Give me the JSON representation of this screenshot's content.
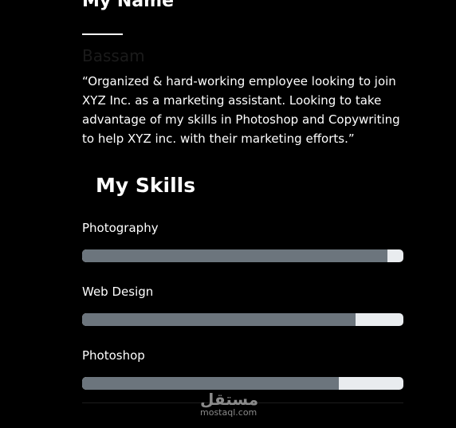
{
  "profile": {
    "heading": "My Name",
    "name": "Bassam",
    "bio": "“Organized & hard-working employee looking to join XYZ Inc. as a marketing assistant. Looking to take advantage of my skills in Photoshop and Copywriting to help XYZ inc. with their marketing efforts.”"
  },
  "skills": {
    "heading": "My Skills",
    "items": [
      {
        "label": "Photography",
        "level": 0.95
      },
      {
        "label": "Web Design",
        "level": 0.85
      },
      {
        "label": "Photoshop",
        "level": 0.8
      }
    ]
  },
  "colors": {
    "background": "#000000",
    "bar_fill": "#6c757d",
    "bar_track": "#e9ecef"
  },
  "watermark": {
    "logo": "مستقل",
    "text": "mostaql.com"
  }
}
